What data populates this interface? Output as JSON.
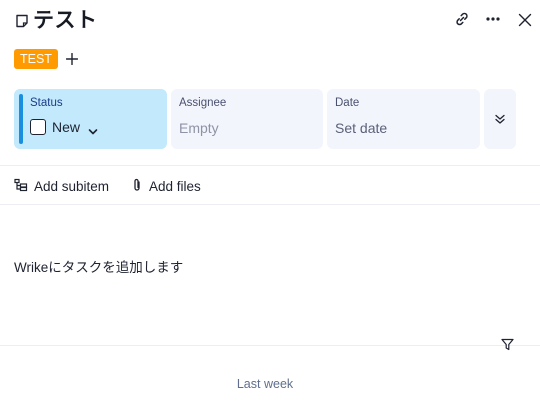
{
  "header": {
    "title": "テスト",
    "icons": [
      "document-icon",
      "link-icon",
      "more-icon",
      "close-icon"
    ]
  },
  "tags": [
    {
      "label": "TEST",
      "color": "#ff9b00"
    }
  ],
  "fields": {
    "status": {
      "label": "Status",
      "value": "New",
      "accent": "#1a8fe0",
      "background": "#c2e9fc"
    },
    "assignee": {
      "label": "Assignee",
      "value": "Empty"
    },
    "date": {
      "label": "Date",
      "value": "Set date"
    }
  },
  "actions": {
    "add_subitem": "Add subitem",
    "add_files": "Add files"
  },
  "description": "Wrikeにタスクを追加します",
  "activity": {
    "section_label": "Last week"
  }
}
